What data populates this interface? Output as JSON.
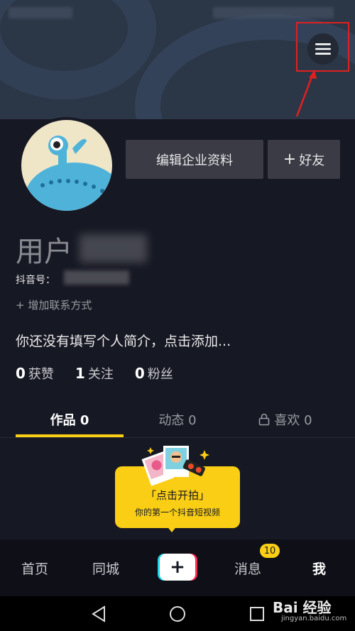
{
  "header": {
    "menu_icon": "hamburger-icon"
  },
  "profile": {
    "edit_button": "编辑企业资料",
    "friend_button_plus": "+",
    "friend_button": "好友",
    "username": "用户",
    "douyin_id_label": "抖音号：",
    "add_contact": "+ 增加联系方式",
    "bio": "你还没有填写个人简介，点击添加..."
  },
  "stats": [
    {
      "num": "0",
      "label": "获赞"
    },
    {
      "num": "1",
      "label": "关注"
    },
    {
      "num": "0",
      "label": "粉丝"
    }
  ],
  "tabs": [
    {
      "label": "作品 0"
    },
    {
      "label": "动态 0"
    },
    {
      "label": "喜欢 0",
      "icon": "lock-icon"
    }
  ],
  "prompt": {
    "title": "「点击开拍」",
    "subtitle": "你的第一个抖音短视频"
  },
  "bottom_nav": {
    "home": "首页",
    "city": "同城",
    "plus": "+",
    "messages": "消息",
    "messages_badge": "10",
    "me": "我"
  },
  "watermark": {
    "brand": "Bai 经验",
    "url": "jingyan.baidu.com"
  },
  "colors": {
    "accent": "#face15",
    "background": "#161823",
    "highlight": "#e02020"
  }
}
